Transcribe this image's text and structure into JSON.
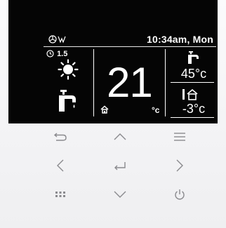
{
  "screen": {
    "status_bar": {
      "time": "10:34am, Mon",
      "icons": [
        "fan-icon",
        "wifi-icon"
      ]
    },
    "timer": {
      "icon": "clock-icon",
      "value": "1.5"
    },
    "mode_icons": [
      "sun-icon",
      "faucet-icon"
    ],
    "room_temperature": {
      "value": "21",
      "unit": "°c"
    },
    "hot_water": {
      "icon": "faucet-icon",
      "value": "45°c"
    },
    "outdoor": {
      "icon": "house-icon",
      "value": "-3°c"
    }
  },
  "keypad": {
    "keys": [
      {
        "name": "back-icon"
      },
      {
        "name": "up-icon"
      },
      {
        "name": "menu-icon"
      },
      {
        "name": "left-icon"
      },
      {
        "name": "enter-icon"
      },
      {
        "name": "right-icon"
      },
      {
        "name": "grid-icon"
      },
      {
        "name": "down-icon"
      },
      {
        "name": "power-icon"
      }
    ]
  },
  "colors": {
    "screen_bg": "#050505",
    "screen_fg": "#ffffff",
    "panel_bg": "#f4f4f5",
    "key_icon": "#8a8a8e"
  }
}
